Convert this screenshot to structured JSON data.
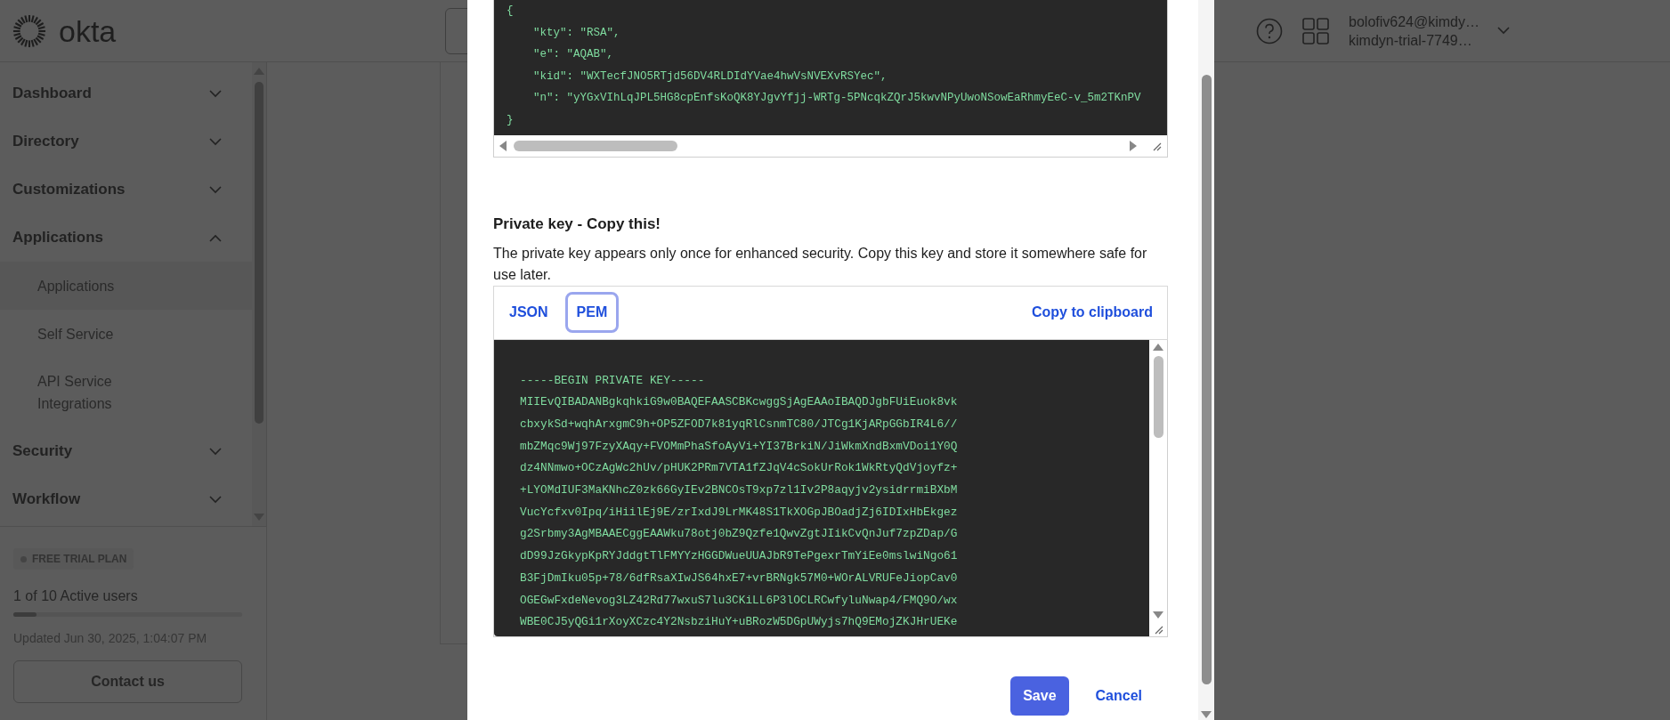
{
  "header": {
    "logo": "okta",
    "user_email": "bolofiv624@kimdy…",
    "org_name": "kimdyn-trial-7749…"
  },
  "sidebar": {
    "nav": [
      {
        "label": "Dashboard",
        "expanded": false
      },
      {
        "label": "Directory",
        "expanded": false
      },
      {
        "label": "Customizations",
        "expanded": false
      },
      {
        "label": "Applications",
        "expanded": true,
        "children": [
          {
            "label": "Applications",
            "selected": true
          },
          {
            "label": "Self Service",
            "selected": false
          },
          {
            "label": "API Service Integrations",
            "selected": false
          }
        ]
      },
      {
        "label": "Security",
        "expanded": false
      },
      {
        "label": "Workflow",
        "expanded": false
      }
    ],
    "plan_badge": "FREE TRIAL PLAN",
    "users": {
      "label": "1 of 10 Active users",
      "level": 0.1
    },
    "updated": "Updated Jun 30, 2025, 1:04:07 PM",
    "contact_button": "Contact us"
  },
  "dialog": {
    "public_key_lines": [
      "{",
      "    \"kty\": \"RSA\",",
      "    \"e\": \"AQAB\",",
      "    \"kid\": \"WXTecfJNO5RTjd56DV4RLDIdYVae4hwVsNVEXvRSYec\",",
      "    \"n\": \"yYGxVIhLqJPL5HG8cpEnfsKoQK8YJgvYfjj-WRTg-5PNcqkZQrJ5kwvNPyUwoNSowEaRhmyEeC-v_5m2TKnPV",
      "}"
    ],
    "private_key": {
      "title": "Private key - Copy this!",
      "description": "The private key appears only once for enhanced security. Copy this key and store it somewhere safe for use later.",
      "tabs": [
        {
          "label": "JSON",
          "selected": false
        },
        {
          "label": "PEM",
          "selected": true
        }
      ],
      "copy_link": "Copy to clipboard",
      "pem_lines": [
        "-----BEGIN PRIVATE KEY-----",
        "MIIEvQIBADANBgkqhkiG9w0BAQEFAASCBKcwggSjAgEAAoIBAQDJgbFUiEuok8vk",
        "cbxykSd+wqhArxgmC9h+OP5ZFOD7k81yqRlCsnmTC80/JTCg1KjARpGGbIR4L6//",
        "mbZMqc9Wj97FzyXAqy+FVOMmPhaSfoAyVi+YI37BrkiN/JiWkmXndBxmVDoi1Y0Q",
        "dz4NNmwo+OCzAgWc2hUv/pHUK2PRm7VTA1fZJqV4cSokUrRok1WkRtyQdVjoyfz+",
        "+LYOMdIUF3MaKNhcZ0zk66GyIEv2BNCOsT9xp7zl1Iv2P8aqyjv2ysidrrmiBXbM",
        "VucYcfxv0Ipq/iHiilEj9E/zrIxdJ9LrMK48S1TkXOGpJBOadjZj6IDIxHbEkgez",
        "g2Srbmy3AgMBAAECggEAAWku78otj0bZ9Qzfe1QwvZgtJIikCvQnJuf7zpZDap/G",
        "dD99JzGkypKpRYJddgtTlFMYYzHGGDWueUUAJbR9TePgexrTmYiEe0mslwiNgo61",
        "B3FjDmIku05p+78/6dfRsaXIwJS64hxE7+vrBRNgk57M0+WOrALVRUFeJiopCav0",
        "OGEGwFxdeNevog3LZ42Rd77wxuS7lu3CKiLL6P3lOCLRCwfyluNwap4/FMQ9O/wx",
        "WBE0CJ5yQGi1rXoyXCzc4Y2NsbziHuY+uBRozW5DGpUWyjs7hQ9EMojZKJHrUEKe"
      ]
    },
    "buttons": [
      {
        "label": "Save",
        "kind": "primary"
      },
      {
        "label": "Cancel",
        "kind": "link"
      }
    ]
  }
}
